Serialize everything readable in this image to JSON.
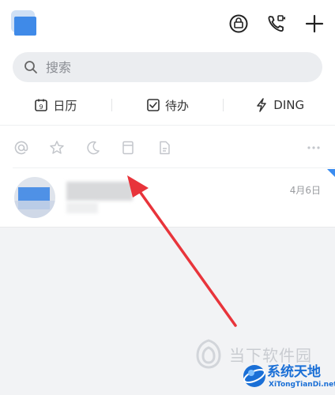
{
  "header": {
    "logo_icon": "app-logo-icon",
    "actions": [
      {
        "name": "secret-chat-button",
        "icon": "lock-badge-icon"
      },
      {
        "name": "call-button",
        "icon": "phone-video-icon"
      },
      {
        "name": "add-button",
        "icon": "plus-icon"
      }
    ]
  },
  "search": {
    "placeholder": "搜索"
  },
  "shortcuts": [
    {
      "label": "日历",
      "icon": "calendar-icon"
    },
    {
      "label": "待办",
      "icon": "checkbox-icon"
    },
    {
      "label": "DING",
      "icon": "lightning-icon"
    }
  ],
  "filters": [
    "at-icon",
    "star-icon",
    "moon-icon",
    "bookmark-icon",
    "document-icon",
    "more-icon"
  ],
  "conversation": {
    "date": "4月6日"
  },
  "watermarks": {
    "site1": "当下软件园",
    "site2_title": "系统天地",
    "site2_url": "XiTongTianDi.net"
  },
  "colors": {
    "accent": "#3a8cf0",
    "arrow": "#e8343b"
  }
}
